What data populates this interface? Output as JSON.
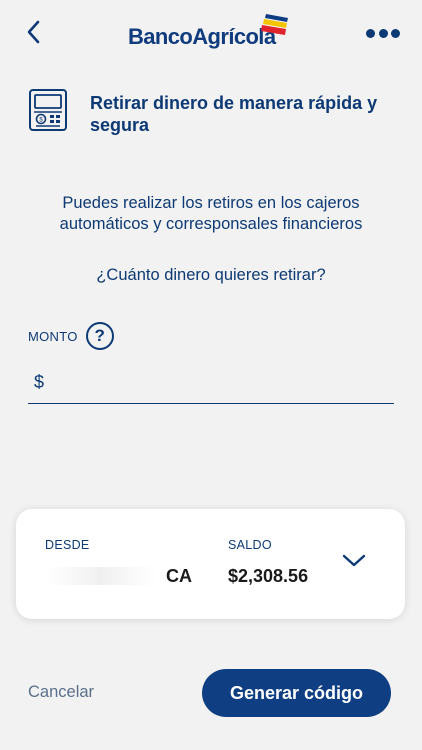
{
  "header": {
    "back_icon": "chevron-left-icon",
    "logo_text": "BancoAgrícola",
    "more_icon": "more-horizontal-icon"
  },
  "feature": {
    "icon": "atm-icon",
    "title": "Retirar dinero de manera rápida y segura"
  },
  "info_text": "Puedes realizar los retiros en los cajeros automáticos y corresponsales financieros",
  "question": "¿Cuánto dinero quieres retirar?",
  "amount": {
    "label": "MONTO",
    "help_icon_text": "?",
    "currency": "$",
    "value": ""
  },
  "account": {
    "from_label": "DESDE",
    "type": "CA",
    "balance_label": "SALDO",
    "balance": "$2,308.56"
  },
  "actions": {
    "cancel_label": "Cancelar",
    "generate_label": "Generar código"
  },
  "colors": {
    "primary": "#0f3f82",
    "text": "#0d3a74",
    "background": "#f2f2f2"
  }
}
